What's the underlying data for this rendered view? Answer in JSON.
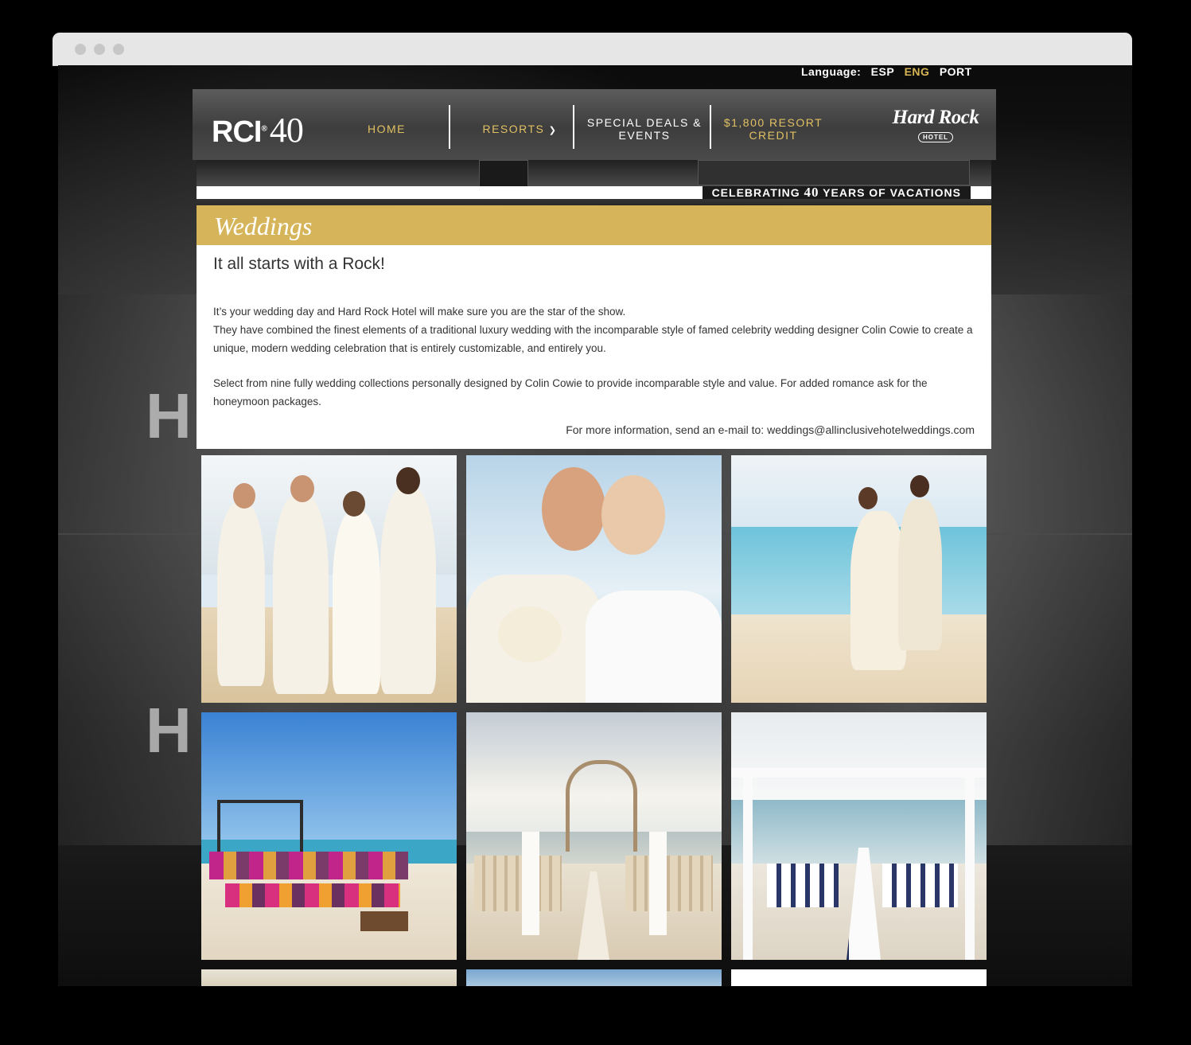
{
  "language": {
    "label": "Language:",
    "options": [
      "ESP",
      "ENG",
      "PORT"
    ],
    "active": "ENG"
  },
  "nav": {
    "logo_rci": "RCI",
    "logo_forty": "40",
    "home": "HOME",
    "resorts": "RESORTS",
    "deals_line1": "SPECIAL DEALS &",
    "deals_line2": "EVENTS",
    "credit_line1": "$1,800 RESORT",
    "credit_line2": "CREDIT",
    "hr_name": "Hard Rock",
    "hr_hotel": "HOTEL"
  },
  "banner": {
    "pre": "CELEBRATING ",
    "number": "40",
    "post": " YEARS OF VACATIONS"
  },
  "section": {
    "title": "Weddings",
    "heading": "It all starts with a Rock!",
    "p1_line1": "It’s your wedding day and Hard Rock Hotel will make sure you are the star of the show.",
    "p1_line2": "They have combined the finest elements of a traditional luxury wedding with the incomparable style of famed celebrity wedding designer Colin Cowie to create a unique, modern wedding celebration that is entirely customizable, and entirely you.",
    "p2": "Select from nine fully wedding collections personally designed by Colin Cowie to provide incomparable style and value. For added romance ask for the honeymoon packages.",
    "contact": "For more information, send an e-mail to: weddings@allinclusivehotelweddings.com"
  },
  "colors": {
    "gold": "#d6b55a",
    "nav_gold": "#e1c063",
    "text": "#333333"
  }
}
